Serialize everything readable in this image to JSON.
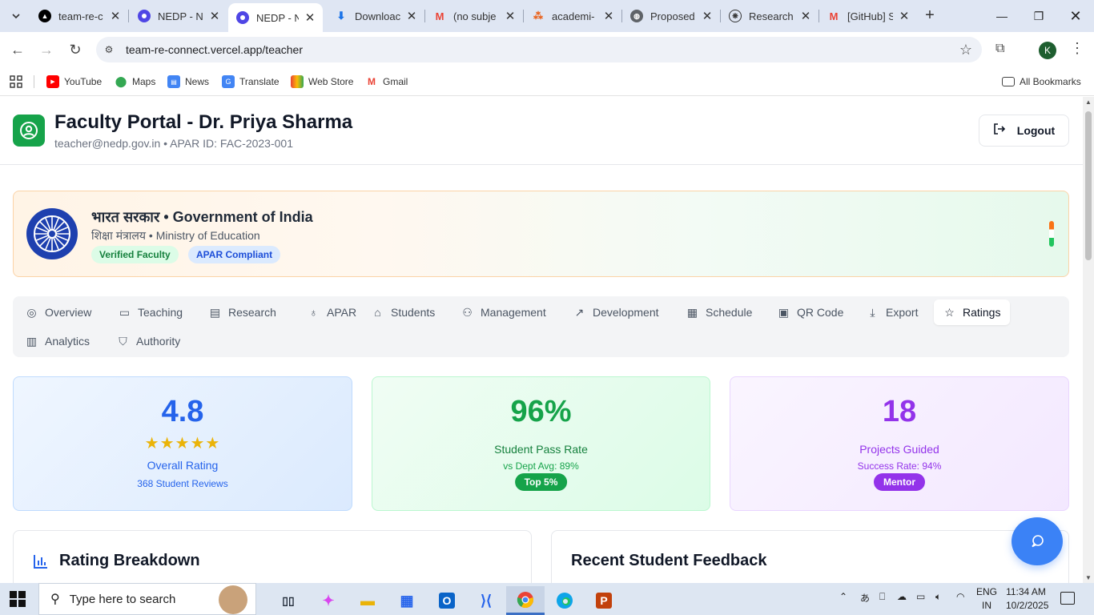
{
  "browser": {
    "tabs": [
      {
        "title": "team-re-c",
        "icon": "vercel-icon"
      },
      {
        "title": "NEDP - N",
        "icon": "nedp-icon"
      },
      {
        "title": "NEDP - N",
        "icon": "nedp-icon",
        "active": true
      },
      {
        "title": "Downloac",
        "icon": "download-icon"
      },
      {
        "title": "(no subje",
        "icon": "gmail-icon"
      },
      {
        "title": "academi-",
        "icon": "app-icon"
      },
      {
        "title": "Proposed",
        "icon": "globe-icon"
      },
      {
        "title": "Research",
        "icon": "openai-icon"
      },
      {
        "title": "[GitHub] S",
        "icon": "gmail-icon"
      }
    ],
    "url": "team-re-connect.vercel.app/teacher",
    "profile_initial": "K",
    "bookmarks": [
      "YouTube",
      "Maps",
      "News",
      "Translate",
      "Web Store",
      "Gmail"
    ],
    "all_bookmarks": "All Bookmarks"
  },
  "header": {
    "title": "Faculty Portal - Dr. Priya Sharma",
    "subtitle": "teacher@nedp.gov.in • APAR ID: FAC-2023-001",
    "logout_label": "Logout"
  },
  "gov_banner": {
    "title": "भारत सरकार • Government of India",
    "subtitle": "शिक्षा मंत्रालय • Ministry of Education",
    "badges": [
      "Verified Faculty",
      "APAR Compliant"
    ]
  },
  "tabs": [
    {
      "label": "Overview",
      "icon": "user-circle-icon"
    },
    {
      "label": "Teaching",
      "icon": "book-icon"
    },
    {
      "label": "Research",
      "icon": "file-text-icon"
    },
    {
      "label": "APAR",
      "icon": "award-icon"
    },
    {
      "label": "Students",
      "icon": "graduation-cap-icon"
    },
    {
      "label": "Management",
      "icon": "users-icon"
    },
    {
      "label": "Development",
      "icon": "trending-up-icon"
    },
    {
      "label": "Schedule",
      "icon": "calendar-icon"
    },
    {
      "label": "QR Code",
      "icon": "qr-code-icon"
    },
    {
      "label": "Export",
      "icon": "download-icon"
    },
    {
      "label": "Ratings",
      "icon": "star-icon",
      "active": true
    },
    {
      "label": "Analytics",
      "icon": "bar-chart-icon"
    },
    {
      "label": "Authority",
      "icon": "shield-icon"
    }
  ],
  "stats": {
    "rating": {
      "value": "4.8",
      "stars": 5,
      "label": "Overall Rating",
      "sub": "368 Student Reviews",
      "color": "#2563eb"
    },
    "pass": {
      "value": "96%",
      "label": "Student Pass Rate",
      "sub": "vs Dept Avg: 89%",
      "pill": "Top 5%",
      "color": "#16a34a"
    },
    "projects": {
      "value": "18",
      "label": "Projects Guided",
      "sub": "Success Rate: 94%",
      "pill": "Mentor",
      "color": "#9333ea"
    }
  },
  "sections": {
    "breakdown_title": "Rating Breakdown",
    "feedback_title": "Recent Student Feedback"
  },
  "taskbar": {
    "search_placeholder": "Type here to search",
    "lang_line1": "ENG",
    "lang_line2": "IN",
    "time": "11:34 AM",
    "date": "10/2/2025"
  }
}
